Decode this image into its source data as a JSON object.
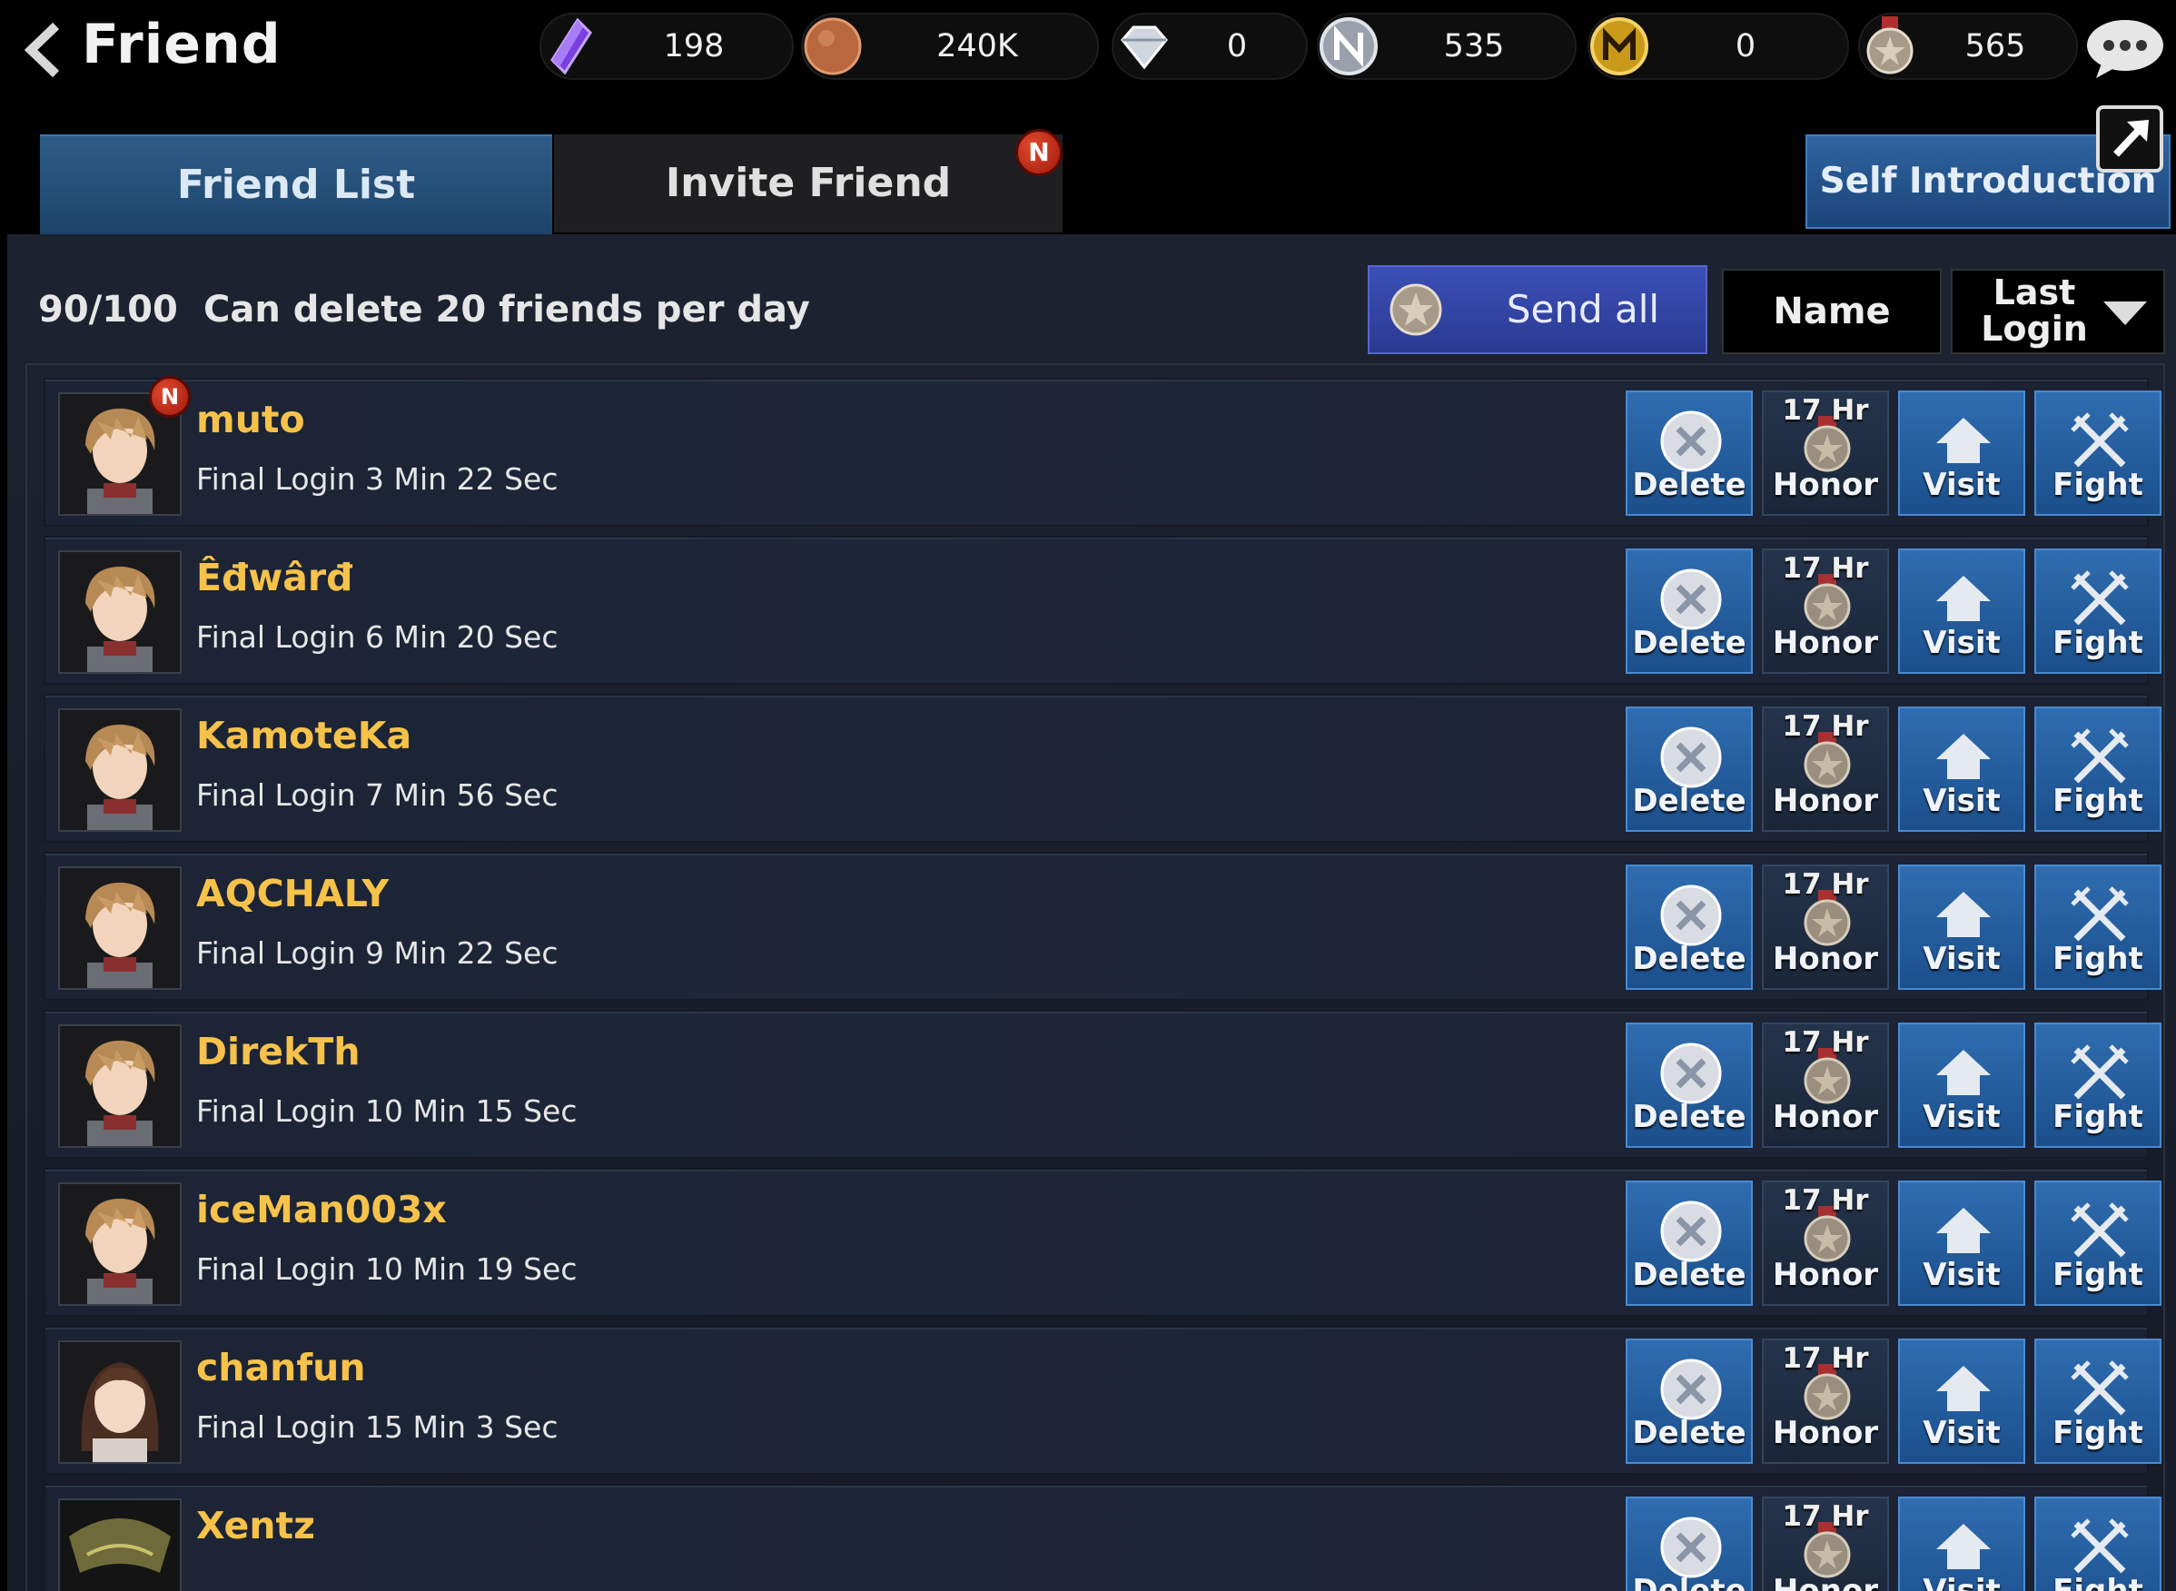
{
  "header": {
    "title": "Friend",
    "currencies": [
      {
        "name": "crystal-icon",
        "value": "198"
      },
      {
        "name": "copper-coin-icon",
        "value": "240K"
      },
      {
        "name": "diamond-icon",
        "value": "0"
      },
      {
        "name": "silver-emblem-icon",
        "value": "535"
      },
      {
        "name": "gold-emblem-icon",
        "value": "0"
      },
      {
        "name": "honor-medal-icon",
        "value": "565"
      }
    ]
  },
  "tabs": {
    "friend_list": "Friend List",
    "invite_friend": "Invite Friend",
    "new_badge": "N"
  },
  "self_intro": "Self Introduction",
  "toolbar": {
    "count": "90/100",
    "delete_note": "Can delete 20 friends per day",
    "send_all": "Send all",
    "sort_name": "Name",
    "sort_last_login": "Last Login"
  },
  "actions": {
    "delete": "Delete",
    "honor": "Honor",
    "honor_timer": "17 Hr",
    "visit": "Visit",
    "fight": "Fight"
  },
  "friends": [
    {
      "name": "muto",
      "login": "Final Login 3 Min 22 Sec",
      "badge": "N",
      "avatar": "male"
    },
    {
      "name": "Êđwârđ",
      "login": "Final Login 6 Min 20 Sec",
      "badge": "",
      "avatar": "male"
    },
    {
      "name": "KamoteKa",
      "login": "Final Login 7 Min 56 Sec",
      "badge": "",
      "avatar": "male"
    },
    {
      "name": "AQCHALY",
      "login": "Final Login 9 Min 22 Sec",
      "badge": "",
      "avatar": "male"
    },
    {
      "name": "DirekTh",
      "login": "Final Login 10 Min 15 Sec",
      "badge": "",
      "avatar": "male"
    },
    {
      "name": "iceMan003x",
      "login": "Final Login 10 Min 19 Sec",
      "badge": "",
      "avatar": "male"
    },
    {
      "name": "chanfun",
      "login": "Final Login 15 Min 3 Sec",
      "badge": "",
      "avatar": "female"
    },
    {
      "name": "Xentz",
      "login": "",
      "badge": "",
      "avatar": "dark"
    }
  ],
  "colors": {
    "accent_blue": "#2f6db0",
    "friend_name": "#f6c24a",
    "badge_red": "#c8281a",
    "send_all": "#3c4fb6"
  }
}
